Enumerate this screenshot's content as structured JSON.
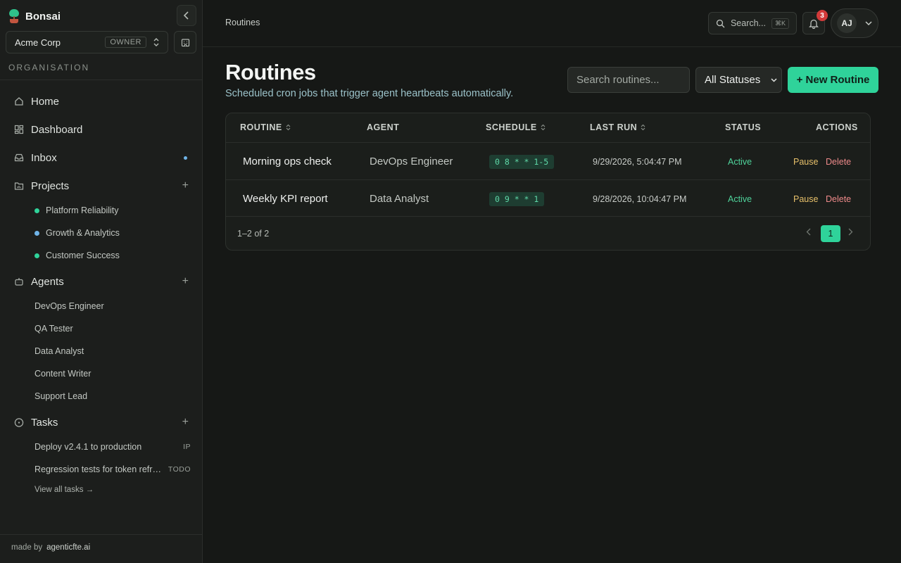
{
  "brand": {
    "name": "Bonsai"
  },
  "org": {
    "name": "Acme Corp",
    "role": "OWNER"
  },
  "sidebar": {
    "section_label": "ORGANISATION",
    "nav": [
      {
        "label": "Home",
        "icon": "home-icon"
      },
      {
        "label": "Dashboard",
        "icon": "dashboard-icon"
      },
      {
        "label": "Inbox",
        "icon": "inbox-icon"
      },
      {
        "label": "Projects",
        "icon": "projects-icon"
      },
      {
        "label": "Agents",
        "icon": "agents-icon"
      },
      {
        "label": "Tasks",
        "icon": "tasks-icon"
      }
    ],
    "projects": [
      {
        "label": "Platform Reliability",
        "color": "#2fd39a"
      },
      {
        "label": "Growth & Analytics",
        "color": "#6fb4e8"
      },
      {
        "label": "Customer Success",
        "color": "#2fd39a"
      }
    ],
    "agents": [
      "DevOps Engineer",
      "QA Tester",
      "Data Analyst",
      "Content Writer",
      "Support Lead"
    ],
    "tasks": [
      {
        "label": "Deploy v2.4.1 to production",
        "status": "IP"
      },
      {
        "label": "Regression tests for token refresh",
        "status": "TODO"
      }
    ],
    "view_all": "View all tasks →",
    "footer_prefix": "made by",
    "footer_by": "agenticfte.ai"
  },
  "topbar": {
    "breadcrumb": "Routines",
    "search_label": "Search...",
    "search_kbd": "⌘K",
    "notification_count": "3",
    "user_initials": "AJ"
  },
  "page": {
    "title": "Routines",
    "subtitle": "Scheduled cron jobs that trigger agent heartbeats automatically.",
    "search_placeholder": "Search routines...",
    "status_filter": "All Statuses",
    "new_button": "+ New Routine"
  },
  "table": {
    "columns": [
      "ROUTINE",
      "AGENT",
      "SCHEDULE",
      "LAST RUN",
      "STATUS",
      "ACTIONS"
    ],
    "rows": [
      {
        "name": "Morning ops check",
        "agent": "DevOps Engineer",
        "schedule": "0 8 * * 1-5",
        "last_run": "9/29/2026, 5:04:47 PM",
        "status": "Active",
        "pause": "Pause",
        "delete": "Delete"
      },
      {
        "name": "Weekly KPI report",
        "agent": "Data Analyst",
        "schedule": "0 9 * * 1",
        "last_run": "9/28/2026, 10:04:47 PM",
        "status": "Active",
        "pause": "Pause",
        "delete": "Delete"
      }
    ],
    "pagination": {
      "summary": "1–2 of 2",
      "current_page": "1"
    }
  },
  "colors": {
    "accent": "#2fd39a",
    "danger": "#d23a3a",
    "warning": "#e7c06a"
  }
}
